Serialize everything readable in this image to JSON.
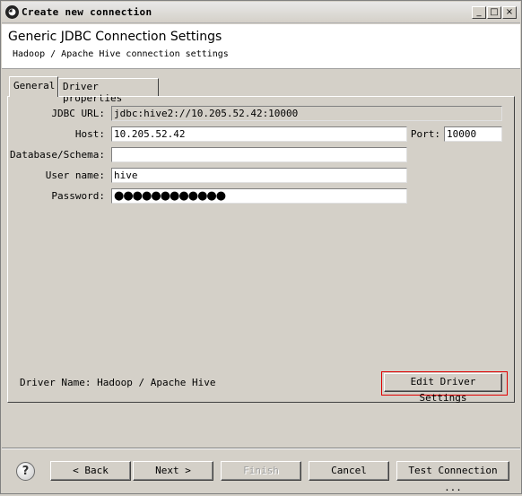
{
  "window": {
    "title": "Create new connection",
    "controls": {
      "minimize": "_",
      "maximize": "□",
      "close": "×"
    },
    "icon": "dbeaver-app-icon"
  },
  "header": {
    "title": "Generic JDBC Connection Settings",
    "subtitle": "Hadoop / Apache Hive connection settings"
  },
  "tabs": [
    {
      "label": "General",
      "active": true
    },
    {
      "label": "Driver properties",
      "active": false
    }
  ],
  "form": {
    "jdbc_url": {
      "label": "JDBC URL:",
      "value": "jdbc:hive2://10.205.52.42:10000"
    },
    "host": {
      "label": "Host:",
      "value": "10.205.52.42"
    },
    "port": {
      "label": "Port:",
      "value": "10000"
    },
    "database": {
      "label": "Database/Schema:",
      "value": ""
    },
    "username": {
      "label": "User name:",
      "value": "hive"
    },
    "password": {
      "label": "Password:",
      "value": "●●●●●●●●●●●●"
    }
  },
  "driver": {
    "name_label": "Driver Name: Hadoop / Apache Hive",
    "edit_button": "Edit Driver Settings"
  },
  "footer": {
    "help_icon": "?",
    "back": "< Back",
    "next": "Next >",
    "finish": "Finish",
    "cancel": "Cancel",
    "test": "Test Connection ..."
  },
  "colors": {
    "highlight": "#e00000",
    "background": "#d4d0c8"
  }
}
